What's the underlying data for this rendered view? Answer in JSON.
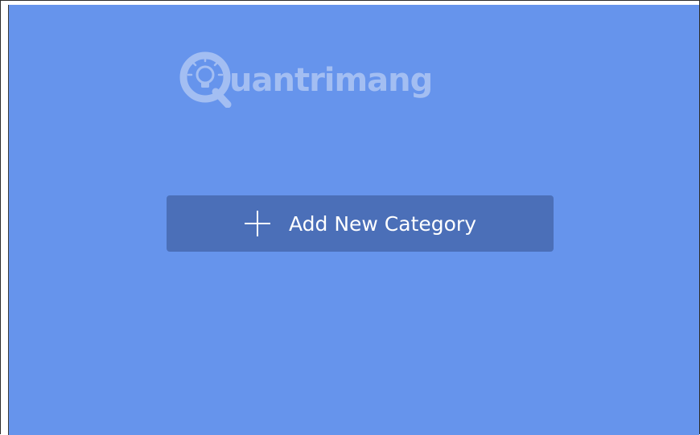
{
  "watermark": {
    "text": "uantrimang",
    "icon": "lightbulb-q-logo-icon"
  },
  "category_button": {
    "icon": "plus-icon",
    "label": "Add New Category"
  },
  "colors": {
    "background": "#6694ec",
    "button": "#4b6fb8",
    "button_text": "#ffffff"
  }
}
